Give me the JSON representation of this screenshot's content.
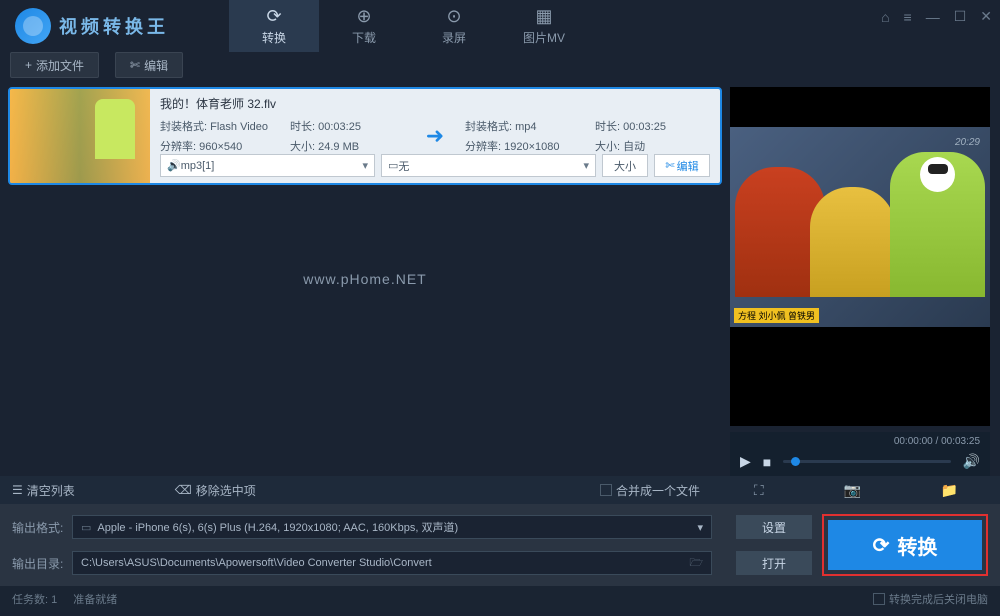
{
  "titlebar": {
    "logo_text": "视频转换王",
    "tabs": [
      {
        "label": "转换",
        "icon": "⟳"
      },
      {
        "label": "下载",
        "icon": "⊕"
      },
      {
        "label": "录屏",
        "icon": "⊙"
      },
      {
        "label": "图片MV",
        "icon": "▦"
      }
    ]
  },
  "toolbar": {
    "add_file": "添加文件",
    "edit": "编辑"
  },
  "file": {
    "title": "我的！体育老师  32.flv",
    "src_format_label": "封装格式:",
    "src_format_value": "Flash Video",
    "src_res_label": "分辨率:",
    "src_res_value": "960×540",
    "src_dur_label": "时长:",
    "src_dur_value": "00:03:25",
    "src_size_label": "大小:",
    "src_size_value": "24.9 MB",
    "dst_format_label": "封装格式:",
    "dst_format_value": "mp4",
    "dst_res_label": "分辨率:",
    "dst_res_value": "1920×1080",
    "dst_dur_label": "时长:",
    "dst_dur_value": "00:03:25",
    "dst_size_label": "大小:",
    "dst_size_value": "自动",
    "audio_dd": "mp3[1]",
    "subtitle_dd": "无",
    "tag": "大小",
    "edit_btn": "编辑"
  },
  "watermark": "www.pHome.NET",
  "preview": {
    "timestamp": "20:29",
    "badge": "方程 刘小佩 曾铁男",
    "time": "00:00:00 / 00:03:25"
  },
  "actions": {
    "clear": "清空列表",
    "remove": "移除选中项",
    "merge": "合并成一个文件"
  },
  "output": {
    "format_label": "输出格式:",
    "format_value": "Apple - iPhone 6(s), 6(s) Plus (H.264, 1920x1080; AAC, 160Kbps, 双声道)",
    "dir_label": "输出目录:",
    "dir_value": "C:\\Users\\ASUS\\Documents\\Apowersoft\\Video Converter Studio\\Convert",
    "settings_btn": "设置",
    "open_btn": "打开",
    "convert_btn": "转换"
  },
  "status": {
    "tasks": "任务数: 1",
    "ready": "准备就绪",
    "shutdown": "转换完成后关闭电脑"
  }
}
